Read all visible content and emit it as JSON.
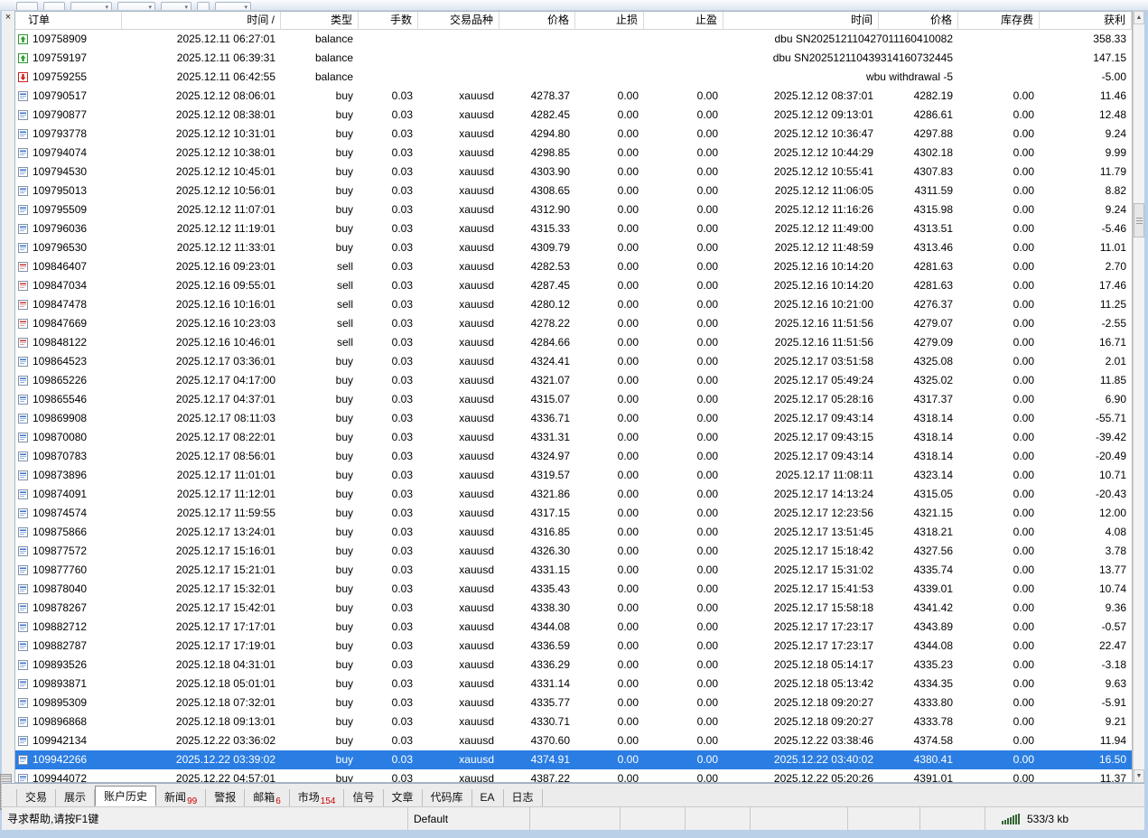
{
  "colors": {
    "selection": "#2a7de2",
    "badge": "#cc0000",
    "buy": "#3a6fc8",
    "buy_light": "#93b1da",
    "sell": "#cc3333",
    "sell_light": "#e0a0a0",
    "deposit": "#2c9a2c",
    "withdrawal": "#cc2222",
    "doc_border": "#8092aa",
    "connection": "#336633"
  },
  "table": {
    "columns": [
      {
        "key": "order",
        "label": "订单",
        "align": "left"
      },
      {
        "key": "open_time",
        "label": "时间 /"
      },
      {
        "key": "type",
        "label": "类型"
      },
      {
        "key": "lots",
        "label": "手数"
      },
      {
        "key": "symbol",
        "label": "交易品种"
      },
      {
        "key": "price",
        "label": "价格"
      },
      {
        "key": "sl",
        "label": "止损"
      },
      {
        "key": "tp",
        "label": "止盈"
      },
      {
        "key": "close_time",
        "label": "时间"
      },
      {
        "key": "close_price",
        "label": "价格"
      },
      {
        "key": "swap",
        "label": "库存费"
      },
      {
        "key": "profit",
        "label": "获利"
      }
    ],
    "rows": [
      {
        "icon": "deposit",
        "order": "109758909",
        "open_time": "2025.12.11 06:27:01",
        "type": "balance",
        "comment": "dbu SN202512110427011160410082",
        "profit": "358.33"
      },
      {
        "icon": "deposit",
        "order": "109759197",
        "open_time": "2025.12.11 06:39:31",
        "type": "balance",
        "comment": "dbu SN202512110439314160732445",
        "profit": "147.15"
      },
      {
        "icon": "withdrawal",
        "order": "109759255",
        "open_time": "2025.12.11 06:42:55",
        "type": "balance",
        "comment": "wbu withdrawal -5",
        "profit": "-5.00"
      },
      {
        "icon": "buy",
        "order": "109790517",
        "open_time": "2025.12.12 08:06:01",
        "type": "buy",
        "lots": "0.03",
        "symbol": "xauusd",
        "price": "4278.37",
        "sl": "0.00",
        "tp": "0.00",
        "close_time": "2025.12.12 08:37:01",
        "close_price": "4282.19",
        "swap": "0.00",
        "profit": "11.46"
      },
      {
        "icon": "buy",
        "order": "109790877",
        "open_time": "2025.12.12 08:38:01",
        "type": "buy",
        "lots": "0.03",
        "symbol": "xauusd",
        "price": "4282.45",
        "sl": "0.00",
        "tp": "0.00",
        "close_time": "2025.12.12 09:13:01",
        "close_price": "4286.61",
        "swap": "0.00",
        "profit": "12.48"
      },
      {
        "icon": "buy",
        "order": "109793778",
        "open_time": "2025.12.12 10:31:01",
        "type": "buy",
        "lots": "0.03",
        "symbol": "xauusd",
        "price": "4294.80",
        "sl": "0.00",
        "tp": "0.00",
        "close_time": "2025.12.12 10:36:47",
        "close_price": "4297.88",
        "swap": "0.00",
        "profit": "9.24"
      },
      {
        "icon": "buy",
        "order": "109794074",
        "open_time": "2025.12.12 10:38:01",
        "type": "buy",
        "lots": "0.03",
        "symbol": "xauusd",
        "price": "4298.85",
        "sl": "0.00",
        "tp": "0.00",
        "close_time": "2025.12.12 10:44:29",
        "close_price": "4302.18",
        "swap": "0.00",
        "profit": "9.99"
      },
      {
        "icon": "buy",
        "order": "109794530",
        "open_time": "2025.12.12 10:45:01",
        "type": "buy",
        "lots": "0.03",
        "symbol": "xauusd",
        "price": "4303.90",
        "sl": "0.00",
        "tp": "0.00",
        "close_time": "2025.12.12 10:55:41",
        "close_price": "4307.83",
        "swap": "0.00",
        "profit": "11.79"
      },
      {
        "icon": "buy",
        "order": "109795013",
        "open_time": "2025.12.12 10:56:01",
        "type": "buy",
        "lots": "0.03",
        "symbol": "xauusd",
        "price": "4308.65",
        "sl": "0.00",
        "tp": "0.00",
        "close_time": "2025.12.12 11:06:05",
        "close_price": "4311.59",
        "swap": "0.00",
        "profit": "8.82"
      },
      {
        "icon": "buy",
        "order": "109795509",
        "open_time": "2025.12.12 11:07:01",
        "type": "buy",
        "lots": "0.03",
        "symbol": "xauusd",
        "price": "4312.90",
        "sl": "0.00",
        "tp": "0.00",
        "close_time": "2025.12.12 11:16:26",
        "close_price": "4315.98",
        "swap": "0.00",
        "profit": "9.24"
      },
      {
        "icon": "buy",
        "order": "109796036",
        "open_time": "2025.12.12 11:19:01",
        "type": "buy",
        "lots": "0.03",
        "symbol": "xauusd",
        "price": "4315.33",
        "sl": "0.00",
        "tp": "0.00",
        "close_time": "2025.12.12 11:49:00",
        "close_price": "4313.51",
        "swap": "0.00",
        "profit": "-5.46"
      },
      {
        "icon": "buy",
        "order": "109796530",
        "open_time": "2025.12.12 11:33:01",
        "type": "buy",
        "lots": "0.03",
        "symbol": "xauusd",
        "price": "4309.79",
        "sl": "0.00",
        "tp": "0.00",
        "close_time": "2025.12.12 11:48:59",
        "close_price": "4313.46",
        "swap": "0.00",
        "profit": "11.01"
      },
      {
        "icon": "sell",
        "order": "109846407",
        "open_time": "2025.12.16 09:23:01",
        "type": "sell",
        "lots": "0.03",
        "symbol": "xauusd",
        "price": "4282.53",
        "sl": "0.00",
        "tp": "0.00",
        "close_time": "2025.12.16 10:14:20",
        "close_price": "4281.63",
        "swap": "0.00",
        "profit": "2.70"
      },
      {
        "icon": "sell",
        "order": "109847034",
        "open_time": "2025.12.16 09:55:01",
        "type": "sell",
        "lots": "0.03",
        "symbol": "xauusd",
        "price": "4287.45",
        "sl": "0.00",
        "tp": "0.00",
        "close_time": "2025.12.16 10:14:20",
        "close_price": "4281.63",
        "swap": "0.00",
        "profit": "17.46"
      },
      {
        "icon": "sell",
        "order": "109847478",
        "open_time": "2025.12.16 10:16:01",
        "type": "sell",
        "lots": "0.03",
        "symbol": "xauusd",
        "price": "4280.12",
        "sl": "0.00",
        "tp": "0.00",
        "close_time": "2025.12.16 10:21:00",
        "close_price": "4276.37",
        "swap": "0.00",
        "profit": "11.25"
      },
      {
        "icon": "sell",
        "order": "109847669",
        "open_time": "2025.12.16 10:23:03",
        "type": "sell",
        "lots": "0.03",
        "symbol": "xauusd",
        "price": "4278.22",
        "sl": "0.00",
        "tp": "0.00",
        "close_time": "2025.12.16 11:51:56",
        "close_price": "4279.07",
        "swap": "0.00",
        "profit": "-2.55"
      },
      {
        "icon": "sell",
        "order": "109848122",
        "open_time": "2025.12.16 10:46:01",
        "type": "sell",
        "lots": "0.03",
        "symbol": "xauusd",
        "price": "4284.66",
        "sl": "0.00",
        "tp": "0.00",
        "close_time": "2025.12.16 11:51:56",
        "close_price": "4279.09",
        "swap": "0.00",
        "profit": "16.71"
      },
      {
        "icon": "buy",
        "order": "109864523",
        "open_time": "2025.12.17 03:36:01",
        "type": "buy",
        "lots": "0.03",
        "symbol": "xauusd",
        "price": "4324.41",
        "sl": "0.00",
        "tp": "0.00",
        "close_time": "2025.12.17 03:51:58",
        "close_price": "4325.08",
        "swap": "0.00",
        "profit": "2.01"
      },
      {
        "icon": "buy",
        "order": "109865226",
        "open_time": "2025.12.17 04:17:00",
        "type": "buy",
        "lots": "0.03",
        "symbol": "xauusd",
        "price": "4321.07",
        "sl": "0.00",
        "tp": "0.00",
        "close_time": "2025.12.17 05:49:24",
        "close_price": "4325.02",
        "swap": "0.00",
        "profit": "11.85"
      },
      {
        "icon": "buy",
        "order": "109865546",
        "open_time": "2025.12.17 04:37:01",
        "type": "buy",
        "lots": "0.03",
        "symbol": "xauusd",
        "price": "4315.07",
        "sl": "0.00",
        "tp": "0.00",
        "close_time": "2025.12.17 05:28:16",
        "close_price": "4317.37",
        "swap": "0.00",
        "profit": "6.90"
      },
      {
        "icon": "buy",
        "order": "109869908",
        "open_time": "2025.12.17 08:11:03",
        "type": "buy",
        "lots": "0.03",
        "symbol": "xauusd",
        "price": "4336.71",
        "sl": "0.00",
        "tp": "0.00",
        "close_time": "2025.12.17 09:43:14",
        "close_price": "4318.14",
        "swap": "0.00",
        "profit": "-55.71"
      },
      {
        "icon": "buy",
        "order": "109870080",
        "open_time": "2025.12.17 08:22:01",
        "type": "buy",
        "lots": "0.03",
        "symbol": "xauusd",
        "price": "4331.31",
        "sl": "0.00",
        "tp": "0.00",
        "close_time": "2025.12.17 09:43:15",
        "close_price": "4318.14",
        "swap": "0.00",
        "profit": "-39.42"
      },
      {
        "icon": "buy",
        "order": "109870783",
        "open_time": "2025.12.17 08:56:01",
        "type": "buy",
        "lots": "0.03",
        "symbol": "xauusd",
        "price": "4324.97",
        "sl": "0.00",
        "tp": "0.00",
        "close_time": "2025.12.17 09:43:14",
        "close_price": "4318.14",
        "swap": "0.00",
        "profit": "-20.49"
      },
      {
        "icon": "buy",
        "order": "109873896",
        "open_time": "2025.12.17 11:01:01",
        "type": "buy",
        "lots": "0.03",
        "symbol": "xauusd",
        "price": "4319.57",
        "sl": "0.00",
        "tp": "0.00",
        "close_time": "2025.12.17 11:08:11",
        "close_price": "4323.14",
        "swap": "0.00",
        "profit": "10.71"
      },
      {
        "icon": "buy",
        "order": "109874091",
        "open_time": "2025.12.17 11:12:01",
        "type": "buy",
        "lots": "0.03",
        "symbol": "xauusd",
        "price": "4321.86",
        "sl": "0.00",
        "tp": "0.00",
        "close_time": "2025.12.17 14:13:24",
        "close_price": "4315.05",
        "swap": "0.00",
        "profit": "-20.43"
      },
      {
        "icon": "buy",
        "order": "109874574",
        "open_time": "2025.12.17 11:59:55",
        "type": "buy",
        "lots": "0.03",
        "symbol": "xauusd",
        "price": "4317.15",
        "sl": "0.00",
        "tp": "0.00",
        "close_time": "2025.12.17 12:23:56",
        "close_price": "4321.15",
        "swap": "0.00",
        "profit": "12.00"
      },
      {
        "icon": "buy",
        "order": "109875866",
        "open_time": "2025.12.17 13:24:01",
        "type": "buy",
        "lots": "0.03",
        "symbol": "xauusd",
        "price": "4316.85",
        "sl": "0.00",
        "tp": "0.00",
        "close_time": "2025.12.17 13:51:45",
        "close_price": "4318.21",
        "swap": "0.00",
        "profit": "4.08"
      },
      {
        "icon": "buy",
        "order": "109877572",
        "open_time": "2025.12.17 15:16:01",
        "type": "buy",
        "lots": "0.03",
        "symbol": "xauusd",
        "price": "4326.30",
        "sl": "0.00",
        "tp": "0.00",
        "close_time": "2025.12.17 15:18:42",
        "close_price": "4327.56",
        "swap": "0.00",
        "profit": "3.78"
      },
      {
        "icon": "buy",
        "order": "109877760",
        "open_time": "2025.12.17 15:21:01",
        "type": "buy",
        "lots": "0.03",
        "symbol": "xauusd",
        "price": "4331.15",
        "sl": "0.00",
        "tp": "0.00",
        "close_time": "2025.12.17 15:31:02",
        "close_price": "4335.74",
        "swap": "0.00",
        "profit": "13.77"
      },
      {
        "icon": "buy",
        "order": "109878040",
        "open_time": "2025.12.17 15:32:01",
        "type": "buy",
        "lots": "0.03",
        "symbol": "xauusd",
        "price": "4335.43",
        "sl": "0.00",
        "tp": "0.00",
        "close_time": "2025.12.17 15:41:53",
        "close_price": "4339.01",
        "swap": "0.00",
        "profit": "10.74"
      },
      {
        "icon": "buy",
        "order": "109878267",
        "open_time": "2025.12.17 15:42:01",
        "type": "buy",
        "lots": "0.03",
        "symbol": "xauusd",
        "price": "4338.30",
        "sl": "0.00",
        "tp": "0.00",
        "close_time": "2025.12.17 15:58:18",
        "close_price": "4341.42",
        "swap": "0.00",
        "profit": "9.36"
      },
      {
        "icon": "buy",
        "order": "109882712",
        "open_time": "2025.12.17 17:17:01",
        "type": "buy",
        "lots": "0.03",
        "symbol": "xauusd",
        "price": "4344.08",
        "sl": "0.00",
        "tp": "0.00",
        "close_time": "2025.12.17 17:23:17",
        "close_price": "4343.89",
        "swap": "0.00",
        "profit": "-0.57"
      },
      {
        "icon": "buy",
        "order": "109882787",
        "open_time": "2025.12.17 17:19:01",
        "type": "buy",
        "lots": "0.03",
        "symbol": "xauusd",
        "price": "4336.59",
        "sl": "0.00",
        "tp": "0.00",
        "close_time": "2025.12.17 17:23:17",
        "close_price": "4344.08",
        "swap": "0.00",
        "profit": "22.47"
      },
      {
        "icon": "buy",
        "order": "109893526",
        "open_time": "2025.12.18 04:31:01",
        "type": "buy",
        "lots": "0.03",
        "symbol": "xauusd",
        "price": "4336.29",
        "sl": "0.00",
        "tp": "0.00",
        "close_time": "2025.12.18 05:14:17",
        "close_price": "4335.23",
        "swap": "0.00",
        "profit": "-3.18"
      },
      {
        "icon": "buy",
        "order": "109893871",
        "open_time": "2025.12.18 05:01:01",
        "type": "buy",
        "lots": "0.03",
        "symbol": "xauusd",
        "price": "4331.14",
        "sl": "0.00",
        "tp": "0.00",
        "close_time": "2025.12.18 05:13:42",
        "close_price": "4334.35",
        "swap": "0.00",
        "profit": "9.63"
      },
      {
        "icon": "buy",
        "order": "109895309",
        "open_time": "2025.12.18 07:32:01",
        "type": "buy",
        "lots": "0.03",
        "symbol": "xauusd",
        "price": "4335.77",
        "sl": "0.00",
        "tp": "0.00",
        "close_time": "2025.12.18 09:20:27",
        "close_price": "4333.80",
        "swap": "0.00",
        "profit": "-5.91"
      },
      {
        "icon": "buy",
        "order": "109896868",
        "open_time": "2025.12.18 09:13:01",
        "type": "buy",
        "lots": "0.03",
        "symbol": "xauusd",
        "price": "4330.71",
        "sl": "0.00",
        "tp": "0.00",
        "close_time": "2025.12.18 09:20:27",
        "close_price": "4333.78",
        "swap": "0.00",
        "profit": "9.21"
      },
      {
        "icon": "buy",
        "order": "109942134",
        "open_time": "2025.12.22 03:36:02",
        "type": "buy",
        "lots": "0.03",
        "symbol": "xauusd",
        "price": "4370.60",
        "sl": "0.00",
        "tp": "0.00",
        "close_time": "2025.12.22 03:38:46",
        "close_price": "4374.58",
        "swap": "0.00",
        "profit": "11.94"
      },
      {
        "icon": "buy",
        "order": "109942266",
        "open_time": "2025.12.22 03:39:02",
        "type": "buy",
        "lots": "0.03",
        "symbol": "xauusd",
        "price": "4374.91",
        "sl": "0.00",
        "tp": "0.00",
        "close_time": "2025.12.22 03:40:02",
        "close_price": "4380.41",
        "swap": "0.00",
        "profit": "16.50",
        "selected": true
      },
      {
        "icon": "buy",
        "order": "109944072",
        "open_time": "2025.12.22 04:57:01",
        "type": "buy",
        "lots": "0.03",
        "symbol": "xauusd",
        "price": "4387.22",
        "sl": "0.00",
        "tp": "0.00",
        "close_time": "2025.12.22 05:20:26",
        "close_price": "4391.01",
        "swap": "0.00",
        "profit": "11.37"
      }
    ]
  },
  "tabs": [
    {
      "id": "trade",
      "label": "交易"
    },
    {
      "id": "exposure",
      "label": "展示"
    },
    {
      "id": "account-history",
      "label": "账户历史",
      "active": true
    },
    {
      "id": "news",
      "label": "新闻",
      "badge": "99"
    },
    {
      "id": "alerts",
      "label": "警报"
    },
    {
      "id": "mailbox",
      "label": "邮箱",
      "badge": "6"
    },
    {
      "id": "market",
      "label": "市场",
      "badge": "154"
    },
    {
      "id": "signals",
      "label": "信号"
    },
    {
      "id": "articles",
      "label": "文章"
    },
    {
      "id": "codebase",
      "label": "代码库"
    },
    {
      "id": "ea",
      "label": "EA"
    },
    {
      "id": "journal",
      "label": "日志"
    }
  ],
  "status": {
    "help": "寻求帮助,请按F1键",
    "profile": "Default",
    "connection": "533/3 kb"
  },
  "misc": {
    "close_glyph": "×",
    "scroll_up_glyph": "▲",
    "scroll_down_glyph": "▼"
  }
}
